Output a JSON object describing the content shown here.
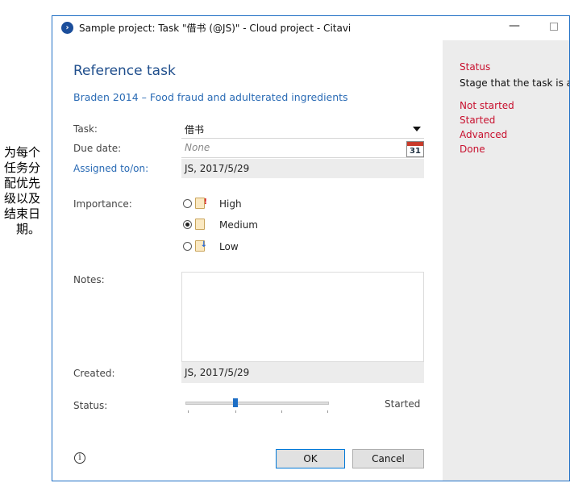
{
  "side_note": "为每个任务分配优先级以及结束日期。",
  "window": {
    "title": "Sample project: Task \"借书 (@JS)\" - Cloud project - Citavi"
  },
  "header": {
    "title": "Reference task",
    "reference": "Braden 2014 – Food fraud and adulterated ingredients"
  },
  "form": {
    "task_label": "Task:",
    "task_value": "借书",
    "due_label": "Due date:",
    "due_placeholder": "None",
    "calendar_day": "31",
    "assigned_label": "Assigned to/on:",
    "assigned_value": "JS, 2017/5/29",
    "importance_label": "Importance:",
    "importance_options": [
      {
        "label": "High",
        "selected": false
      },
      {
        "label": "Medium",
        "selected": true
      },
      {
        "label": "Low",
        "selected": false
      }
    ],
    "notes_label": "Notes:",
    "created_label": "Created:",
    "created_value": "JS, 2017/5/29",
    "status_label": "Status:",
    "status_value": "Started",
    "status_level": 1,
    "status_level_max": 4
  },
  "buttons": {
    "ok": "OK",
    "cancel": "Cancel"
  },
  "help": {
    "title": "Status",
    "description": "Stage that the task is a",
    "items": [
      "Not started",
      "Started",
      "Advanced",
      "Done"
    ]
  },
  "colors": {
    "accent": "#1f6fc5",
    "help_red": "#c8102e",
    "heading_blue": "#1f4e8c"
  }
}
